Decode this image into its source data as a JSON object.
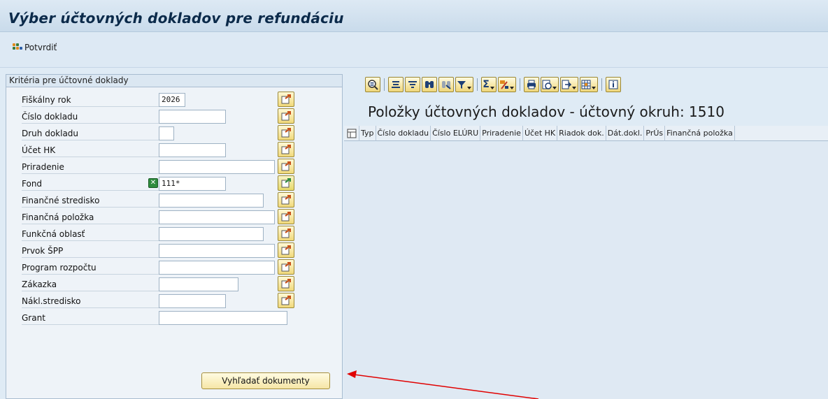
{
  "window": {
    "title": "Výber účtovných dokladov pre refundáciu"
  },
  "toolbar": {
    "confirm_label": "Potvrdiť"
  },
  "criteria": {
    "header": "Kritéria pre účtovné doklady",
    "fields": [
      {
        "label": "Fiškálny rok",
        "value": "2026"
      },
      {
        "label": "Číslo dokladu",
        "value": ""
      },
      {
        "label": "Druh dokladu",
        "value": ""
      },
      {
        "label": "Účet HK",
        "value": ""
      },
      {
        "label": "Priradenie",
        "value": ""
      },
      {
        "label": "Fond",
        "value": "111*"
      },
      {
        "label": "Finančné stredisko",
        "value": ""
      },
      {
        "label": "Finančná položka",
        "value": ""
      },
      {
        "label": "Funkčná oblasť",
        "value": ""
      },
      {
        "label": "Prvok ŠPP",
        "value": ""
      },
      {
        "label": "Program rozpočtu",
        "value": ""
      },
      {
        "label": "Zákazka",
        "value": ""
      },
      {
        "label": "Nákl.stredisko",
        "value": ""
      },
      {
        "label": "Grant",
        "value": ""
      }
    ],
    "search_button": "Vyhľadať dokumenty"
  },
  "alv": {
    "title": "Položky účtovných dokladov - účtovný okruh: 1510",
    "columns": [
      "Typ",
      "Číslo dokladu",
      "Číslo ELÚRU",
      "Priradenie",
      "Účet HK",
      "Riadok dok.",
      "Dát.dokl.",
      "PrÚs",
      "Finančná položka"
    ],
    "toolbar_icons": [
      "details-icon",
      "sort-ascending-icon",
      "sort-descending-icon",
      "find-icon",
      "find-next-icon",
      "filter-icon",
      "sum-icon",
      "subtotal-icon",
      "print-icon",
      "views-icon",
      "export-icon",
      "layout-icon",
      "info-icon"
    ]
  },
  "colors": {
    "accent": "#1d3f76",
    "button": "#f1d97a",
    "annotation_arrow": "#e00000"
  }
}
